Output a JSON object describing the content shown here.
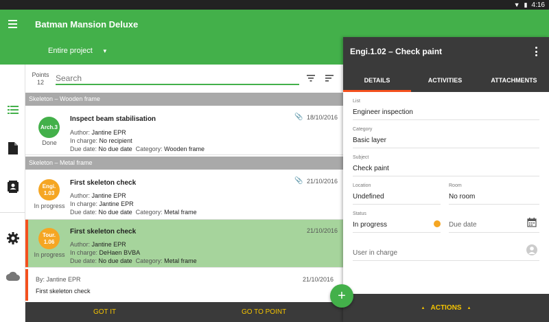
{
  "statusbar": {
    "wifi_icon": "wifi-icon",
    "battery_icon": "battery-icon",
    "time": "4:16"
  },
  "appbar": {
    "title": "Batman Mansion Deluxe",
    "project_filter": "Entire project",
    "colors": {
      "primary": "#43b04a"
    }
  },
  "list": {
    "points_label": "Points",
    "points_count": "12",
    "search_placeholder": "Search",
    "sections": [
      {
        "header": "Skeleton – Wooden frame",
        "items": [
          {
            "badge": "Arch.3",
            "status": "Done",
            "title": "Inspect beam stabilisation",
            "date": "18/10/2016",
            "author_label": "Author:",
            "author": "Jantine EPR",
            "incharge_label": "In charge:",
            "incharge": "No recipient",
            "due_label": "Due date:",
            "due": "No due date",
            "category_label": "Category:",
            "category": "Wooden frame"
          }
        ]
      },
      {
        "header": "Skeleton – Metal frame",
        "items": [
          {
            "badge_line1": "Engi.",
            "badge_line2": "1.03",
            "status": "In progress",
            "title": "First skeleton check",
            "date": "21/10/2016",
            "author_label": "Author:",
            "author": "Jantine EPR",
            "incharge_label": "In charge:",
            "incharge": "Jantine EPR",
            "due_label": "Due date:",
            "due": "No due date",
            "category_label": "Category:",
            "category": "Metal frame"
          },
          {
            "badge_line1": "Tour.",
            "badge_line2": "1.06",
            "status": "In progress",
            "title": "First skeleton check",
            "date": "21/10/2016",
            "author_label": "Author:",
            "author": "Jantine EPR",
            "incharge_label": "In charge:",
            "incharge": "DeHaen BVBA",
            "due_label": "Due date:",
            "due": "No due date",
            "category_label": "Category:",
            "category": "Metal frame"
          }
        ]
      }
    ],
    "comment": {
      "by": "By: Jantine EPR",
      "date": "21/10/2016",
      "text": "First skeleton check"
    },
    "bottom": {
      "got_it": "GOT IT",
      "go_to_point": "GO TO POINT"
    },
    "fab": "+"
  },
  "detail": {
    "title": "Engi.1.02 – Check paint",
    "tabs": [
      "DETAILS",
      "ACTIVITIES",
      "ATTACHMENTS"
    ],
    "fields": {
      "list_label": "List",
      "list_value": "Engineer inspection",
      "category_label": "Category",
      "category_value": "Basic layer",
      "subject_label": "Subject",
      "subject_value": "Check paint",
      "location_label": "Location",
      "location_value": "Undefined",
      "room_label": "Room",
      "room_value": "No room",
      "status_label": "Status",
      "status_value": "In progress",
      "due_placeholder": "Due date",
      "user_placeholder": "User in charge"
    },
    "actions": "ACTIONS",
    "colors": {
      "accent": "#f4511e",
      "status": "#f5a623",
      "action_text": "#f5c400"
    }
  }
}
